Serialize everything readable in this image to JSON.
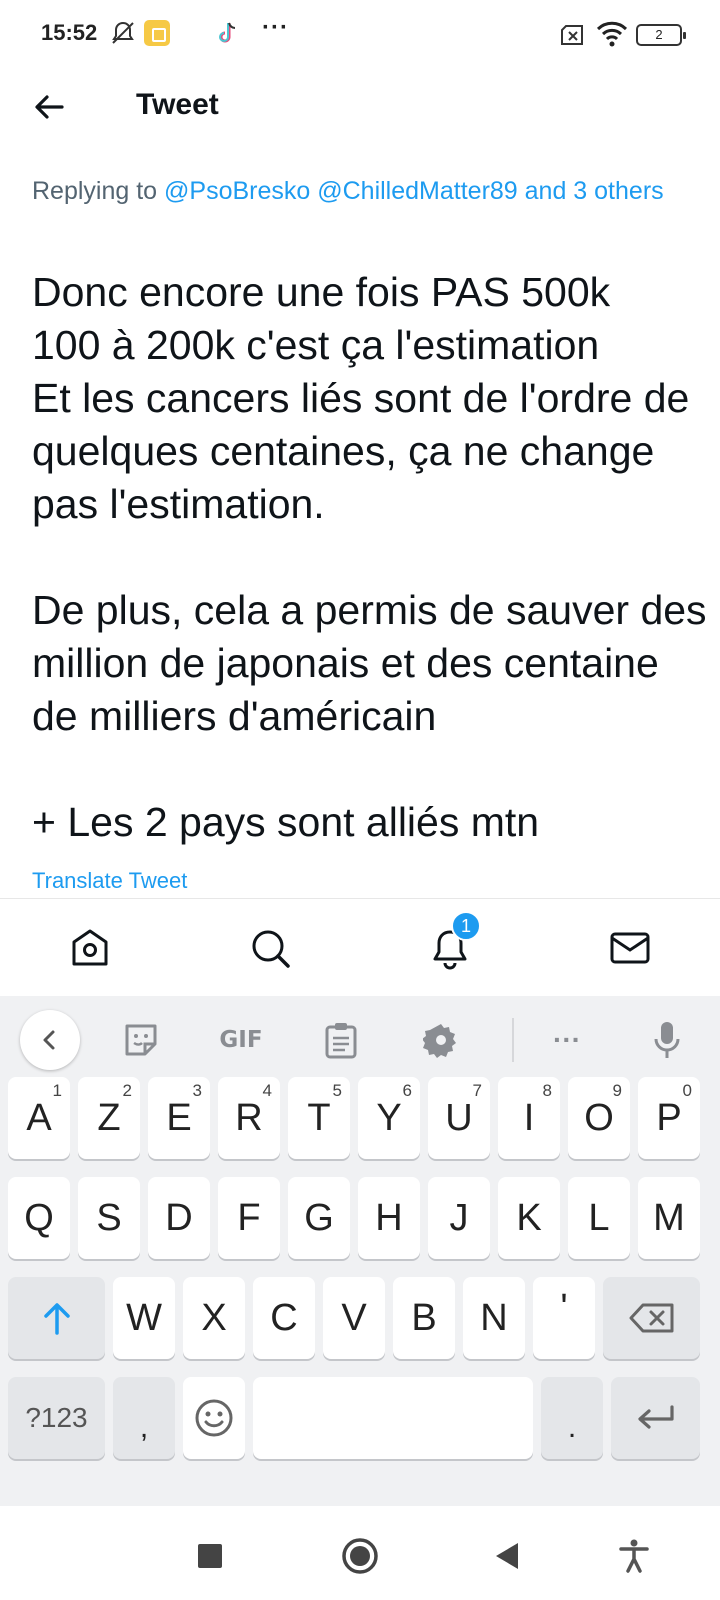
{
  "status_bar": {
    "time": "15:52",
    "battery_level": "2",
    "icons": [
      "bell-off-icon",
      "app-badge-icon",
      "tiktok-icon",
      "more-dots-icon",
      "no-sim-icon",
      "wifi-icon",
      "battery-icon"
    ],
    "dots": "···"
  },
  "header": {
    "title": "Tweet",
    "back_icon": "arrow-left-icon"
  },
  "tweet": {
    "replying_prefix": "Replying to ",
    "replying_handles": "@PsoBresko @ChilledMatter89 and 3 others",
    "body": "Donc encore une fois PAS 500k\n100 à 200k c'est ça l'estimation\nEt les cancers liés sont de l'ordre de quelques centaines, ça ne change pas l'estimation.\n\nDe plus, cela a permis de sauver des million de japonais et des centaine de milliers d'américain\n\n+ Les 2 pays sont alliés mtn",
    "translate_label": "Translate Tweet"
  },
  "bottom_nav": {
    "items": [
      "home-icon",
      "search-icon",
      "notifications-icon",
      "messages-icon"
    ],
    "notification_count": "1"
  },
  "keyboard": {
    "toolbar": {
      "gif_label": "GIF",
      "more_label": "···",
      "icons": [
        "collapse-chevron-icon",
        "sticker-icon",
        "gif-icon",
        "clipboard-icon",
        "settings-icon",
        "more-icon",
        "microphone-icon"
      ]
    },
    "row1": [
      {
        "key": "A",
        "hint": "1"
      },
      {
        "key": "Z",
        "hint": "2"
      },
      {
        "key": "E",
        "hint": "3"
      },
      {
        "key": "R",
        "hint": "4"
      },
      {
        "key": "T",
        "hint": "5"
      },
      {
        "key": "Y",
        "hint": "6"
      },
      {
        "key": "U",
        "hint": "7"
      },
      {
        "key": "I",
        "hint": "8"
      },
      {
        "key": "O",
        "hint": "9"
      },
      {
        "key": "P",
        "hint": "0"
      }
    ],
    "row2": [
      "Q",
      "S",
      "D",
      "F",
      "G",
      "H",
      "J",
      "K",
      "L",
      "M"
    ],
    "row3": [
      "W",
      "X",
      "C",
      "V",
      "B",
      "N",
      "'"
    ],
    "row4": {
      "symbols": "?123",
      "comma": ",",
      "period": "."
    },
    "accent_color": "#1d9bf0"
  },
  "system_nav": {
    "icons": [
      "recent-apps-icon",
      "home-circle-icon",
      "back-triangle-icon",
      "accessibility-icon"
    ]
  }
}
